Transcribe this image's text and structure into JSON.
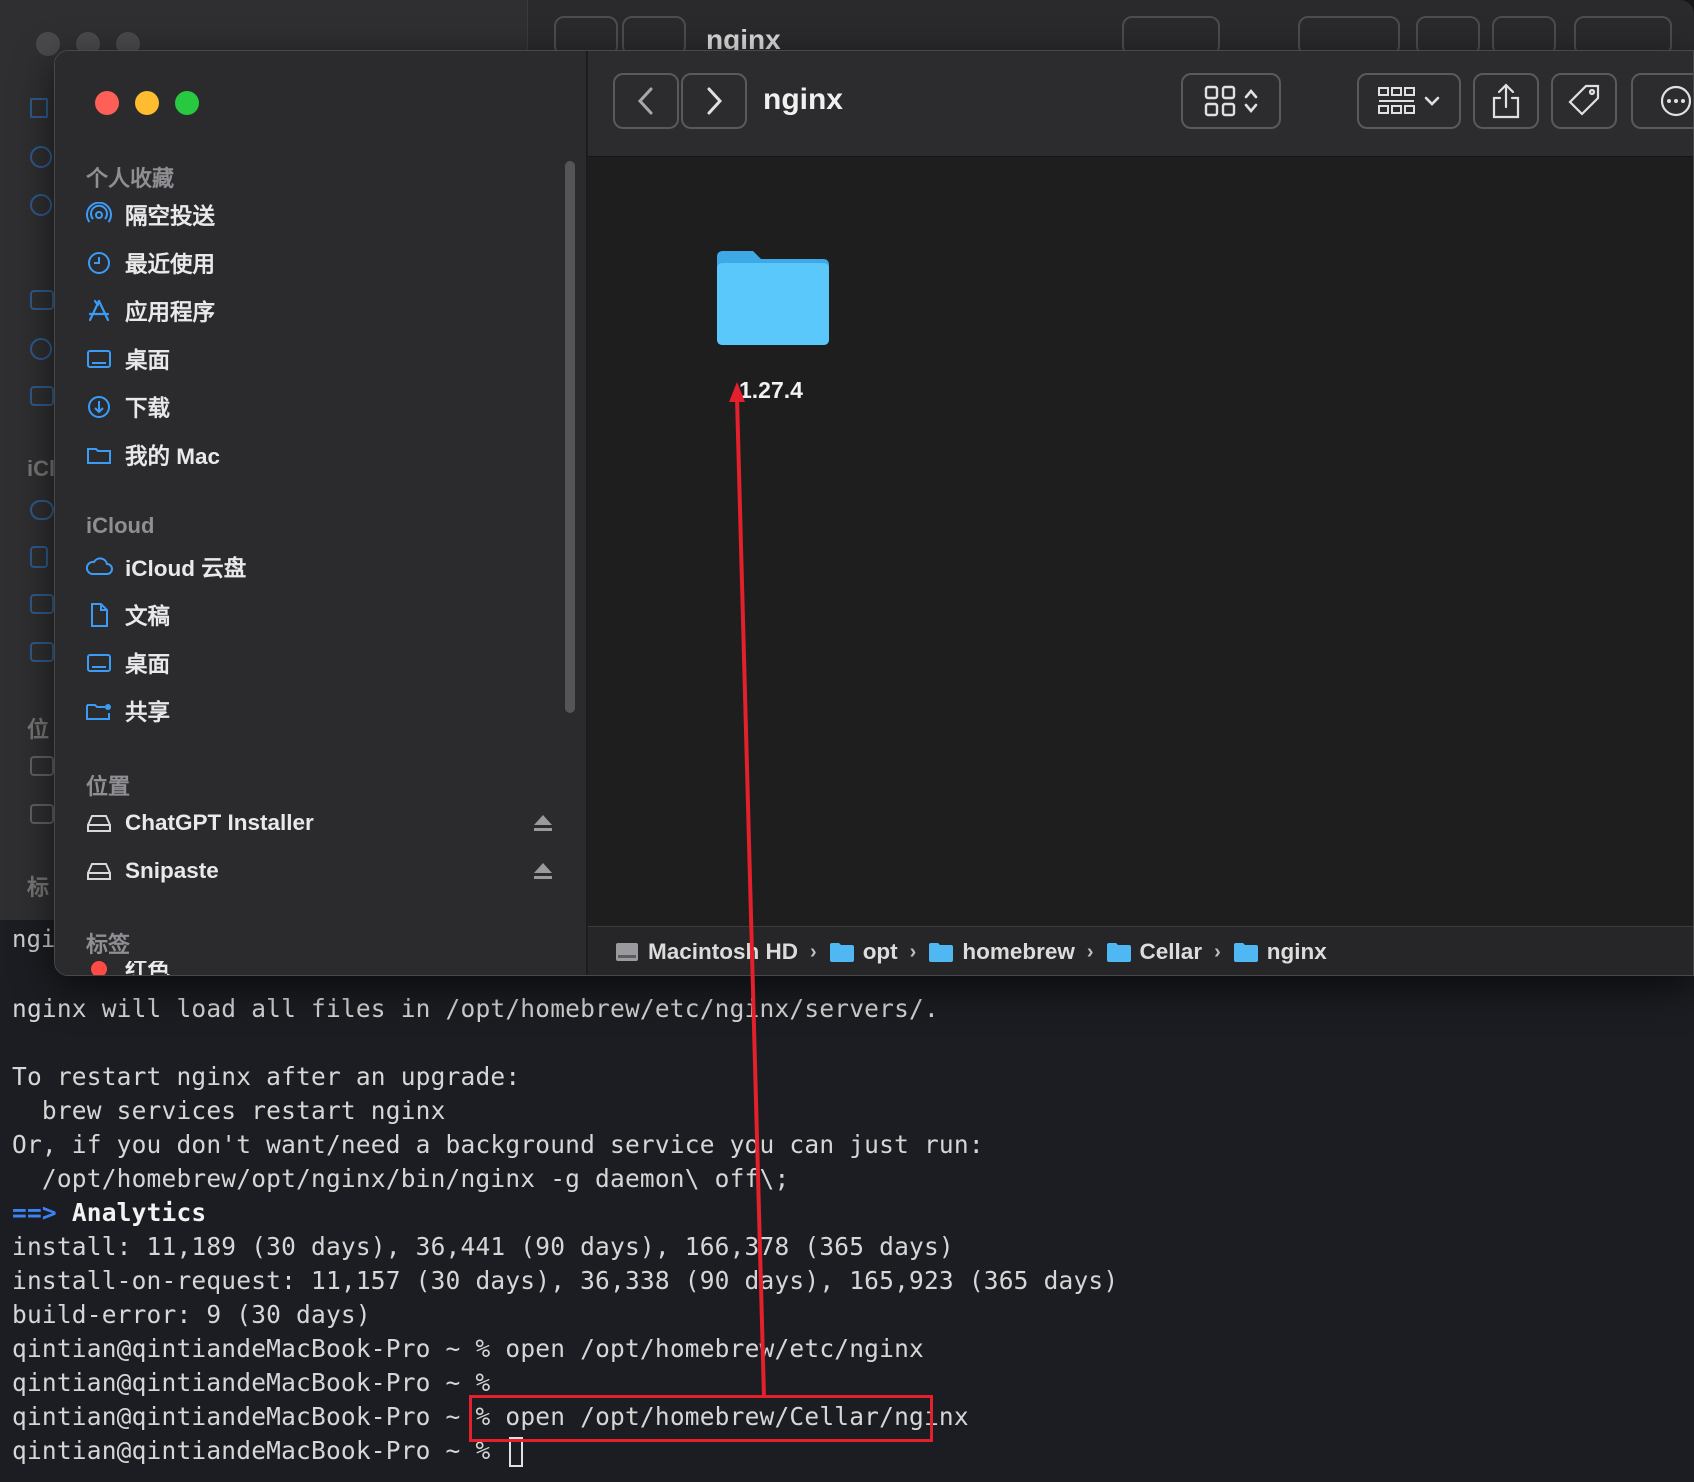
{
  "background_window": {
    "title": "nginx",
    "sidebar_fragments": {
      "icloud": "iCl",
      "locations": "位",
      "tags": "标"
    }
  },
  "finder": {
    "title": "nginx",
    "sidebar": {
      "favorites_title": "个人收藏",
      "favorites": [
        {
          "label": "隔空投送",
          "icon": "airdrop-icon"
        },
        {
          "label": "最近使用",
          "icon": "clock-icon"
        },
        {
          "label": "应用程序",
          "icon": "applications-icon"
        },
        {
          "label": "桌面",
          "icon": "desktop-icon"
        },
        {
          "label": "下载",
          "icon": "download-icon"
        },
        {
          "label": "我的 Mac",
          "icon": "folder-icon"
        }
      ],
      "icloud_title": "iCloud",
      "icloud": [
        {
          "label": "iCloud 云盘",
          "icon": "cloud-icon"
        },
        {
          "label": "文稿",
          "icon": "document-icon"
        },
        {
          "label": "桌面",
          "icon": "desktop-icon"
        },
        {
          "label": "共享",
          "icon": "shared-folder-icon"
        }
      ],
      "locations_title": "位置",
      "locations": [
        {
          "label": "ChatGPT Installer",
          "icon": "drive-icon"
        },
        {
          "label": "Snipaste",
          "icon": "drive-icon"
        }
      ],
      "tags_title": "标签",
      "tags_partial": "红色"
    },
    "content": {
      "items": [
        {
          "name": "1.27.4",
          "icon": "folder-icon"
        }
      ]
    },
    "path_bar": [
      "Macintosh HD",
      "opt",
      "homebrew",
      "Cellar",
      "nginx"
    ]
  },
  "terminal": {
    "partial_line": "ngi",
    "lines": [
      "nginx will load all files in /opt/homebrew/etc/nginx/servers/.",
      "",
      "To restart nginx after an upgrade:",
      "  brew services restart nginx",
      "Or, if you don't want/need a background service you can just run:",
      "  /opt/homebrew/opt/nginx/bin/nginx -g daemon\\ off\\;"
    ],
    "analytics_prefix": "==>",
    "analytics_title": "Analytics",
    "analytics_lines": [
      "install: 11,189 (30 days), 36,441 (90 days), 166,378 (365 days)",
      "install-on-request: 11,157 (30 days), 36,338 (90 days), 165,923 (365 days)",
      "build-error: 9 (30 days)"
    ],
    "prompt": "qintian@qintiandeMacBook-Pro ~ %",
    "commands": [
      " open /opt/homebrew/etc/nginx",
      "",
      " open /opt/homebrew/Cellar/nginx",
      " "
    ]
  },
  "colors": {
    "annotation": "#e3202b",
    "folder": "#5ac8fa",
    "accent": "#3b82f6"
  }
}
